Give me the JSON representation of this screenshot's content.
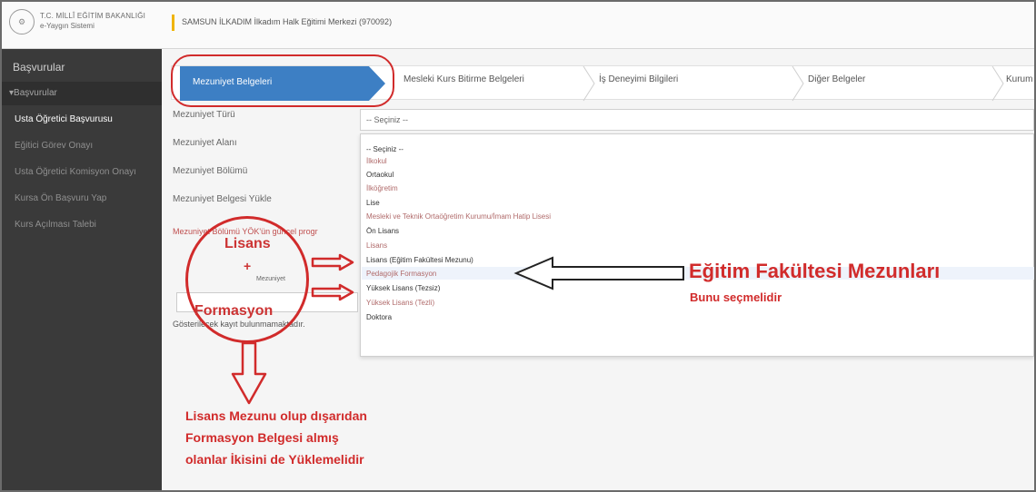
{
  "header": {
    "org_line1": "T.C. MİLLÎ EĞİTİM BAKANLIĞI",
    "org_line2": "e-Yaygın Sistemi",
    "center_title": "SAMSUN İLKADIM İlkadım Halk Eğitimi Merkezi (970092)"
  },
  "sidebar": {
    "title": "Başvurular",
    "group": "Başvurular",
    "items": [
      {
        "label": "Usta Öğretici Başvurusu"
      },
      {
        "label": "Eğitici Görev Onayı"
      },
      {
        "label": "Usta Öğretici Komisyon Onayı"
      },
      {
        "label": "Kursa Ön Başvuru Yap"
      },
      {
        "label": "Kurs Açılması Talebi"
      }
    ]
  },
  "tabs": [
    {
      "label": "Mezuniyet Belgeleri"
    },
    {
      "label": "Mesleki Kurs Bitirme Belgeleri"
    },
    {
      "label": "İş Deneyimi Bilgileri"
    },
    {
      "label": "Diğer Belgeler"
    },
    {
      "label": "Kurum"
    }
  ],
  "form": {
    "labels": [
      "Mezuniyet Türü",
      "Mezuniyet Alanı",
      "Mezuniyet Bölümü",
      "Mezuniyet Belgesi Yükle"
    ],
    "select_value": "-- Seçiniz --",
    "warning": "Mezuniyet Bölümü YÖK'ün güncel progr",
    "search_small": "Mezuniyet",
    "empty_message": "Gösterilecek kayıt bulunmamaktadır."
  },
  "dropdown_options": [
    "-- Seçiniz --",
    "İlkokul",
    "Ortaokul",
    "İlköğretim",
    "Lise",
    "Mesleki ve Teknik Ortaöğretim Kurumu/İmam Hatip Lisesi",
    "Ön Lisans",
    "Lisans",
    "Lisans (Eğitim Fakültesi Mezunu)",
    "Pedagojik Formasyon",
    "Yüksek Lisans (Tezsiz)",
    "Yüksek Lisans (Tezli)",
    "Doktora"
  ],
  "annotations": {
    "lisans": "Lisans",
    "plus": "+",
    "formasyon": "Formasyon",
    "big_title": "Eğitim Fakültesi Mezunları",
    "big_sub": "Bunu seçmelidir",
    "bottom_note_1": "Lisans Mezunu olup dışarıdan",
    "bottom_note_2": "Formasyon Belgesi almış",
    "bottom_note_3": "olanlar İkisini de Yüklemelidir"
  },
  "colors": {
    "accent_tab": "#3d7fc4",
    "annotation_red": "#d12b2b",
    "sidebar_bg": "#3a3a3a"
  }
}
